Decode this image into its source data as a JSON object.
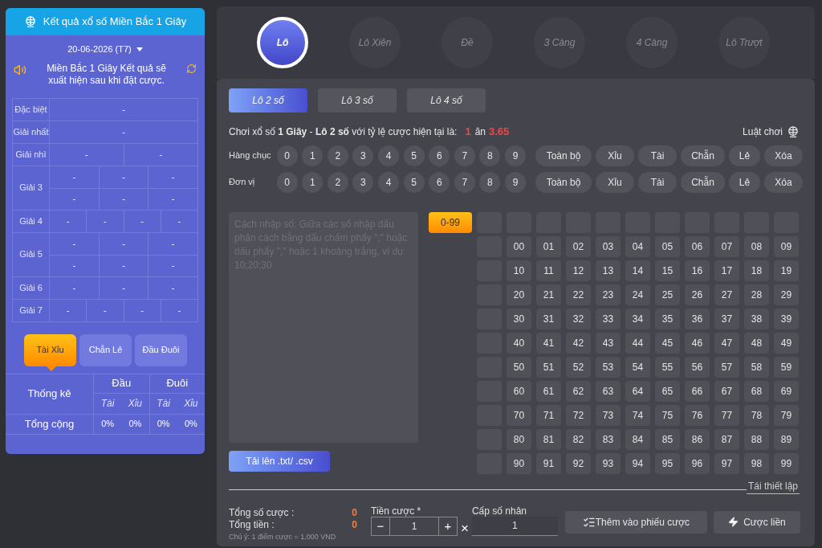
{
  "results": {
    "title": "Kết quả xổ số Miền Bắc 1 Giây",
    "date": "20-06-2026 (T7)",
    "notice": "Miền Bắc 1 Giây Kết quả sẽ xuất hiện sau khi đặt cược.",
    "prizes": [
      {
        "label": "Đặc biệt",
        "rows": [
          [
            "-"
          ]
        ]
      },
      {
        "label": "Giải nhất",
        "rows": [
          [
            "-"
          ]
        ]
      },
      {
        "label": "Giải nhì",
        "rows": [
          [
            "-",
            "-"
          ]
        ]
      },
      {
        "label": "Giải 3",
        "rows": [
          [
            "-",
            "-",
            "-"
          ],
          [
            "-",
            "-",
            "-"
          ]
        ]
      },
      {
        "label": "Giải 4",
        "rows": [
          [
            "-",
            "-",
            "-",
            "-"
          ]
        ]
      },
      {
        "label": "Giải 5",
        "rows": [
          [
            "-",
            "-",
            "-"
          ],
          [
            "-",
            "-",
            "-"
          ]
        ]
      },
      {
        "label": "Giải 6",
        "rows": [
          [
            "-",
            "-",
            "-"
          ]
        ]
      },
      {
        "label": "Giải 7",
        "rows": [
          [
            "-",
            "-",
            "-",
            "-"
          ]
        ]
      }
    ]
  },
  "stat_tabs": [
    {
      "label": "Tài Xỉu",
      "selected": true
    },
    {
      "label": "Chẵn Lẻ",
      "selected": false
    },
    {
      "label": "Đầu Đuôi",
      "selected": false
    }
  ],
  "stats": {
    "corner": "Thống kê",
    "groups": [
      "Đầu",
      "Đuôi"
    ],
    "subheads": [
      "Tài",
      "Xỉu",
      "Tài",
      "Xỉu"
    ],
    "row_label": "Tổng cộng",
    "values": [
      "0%",
      "0%",
      "0%",
      "0%"
    ]
  },
  "game_types": [
    {
      "label": "Lô",
      "selected": true
    },
    {
      "label": "Lô Xiên",
      "selected": false
    },
    {
      "label": "Đề",
      "selected": false
    },
    {
      "label": "3 Càng",
      "selected": false
    },
    {
      "label": "4 Càng",
      "selected": false
    },
    {
      "label": "Lô Trượt",
      "selected": false
    }
  ],
  "sub_tabs": [
    {
      "label": "Lô 2 số",
      "selected": true
    },
    {
      "label": "Lô 3 số",
      "selected": false
    },
    {
      "label": "Lô 4 số",
      "selected": false
    }
  ],
  "odds": {
    "text": "Chơi xổ số **1 Giây** - **Lô 2 số** với tỷ lệ cược hiện tại là:",
    "stake": "1",
    "eat": "ăn",
    "payout": "3.65",
    "rules": "Luật chơi"
  },
  "digit_rows": [
    {
      "label": "Hàng chục",
      "digits": [
        "0",
        "1",
        "2",
        "3",
        "4",
        "5",
        "6",
        "7",
        "8",
        "9"
      ],
      "quick": [
        "Toàn bộ",
        "Xỉu",
        "Tài",
        "Chẵn",
        "Lẻ",
        "Xóa"
      ]
    },
    {
      "label": "Đơn vị",
      "digits": [
        "0",
        "1",
        "2",
        "3",
        "4",
        "5",
        "6",
        "7",
        "8",
        "9"
      ],
      "quick": [
        "Toàn bộ",
        "Xỉu",
        "Tài",
        "Chẵn",
        "Lẻ",
        "Xóa"
      ]
    }
  ],
  "entry": {
    "placeholder": "Cách nhập số: Giữa các số nhập dấu phân cách bằng dấu chấm phẩy \";\" hoặc dấu phẩy \",\" hoặc 1 khoảng trắng, ví dụ: 10;20;30",
    "upload": "Tải lên .txt/ .csv",
    "range": "0-99"
  },
  "numbers": [
    [
      "00",
      "01",
      "02",
      "03",
      "04",
      "05",
      "06",
      "07",
      "08",
      "09"
    ],
    [
      "10",
      "11",
      "12",
      "13",
      "14",
      "15",
      "16",
      "17",
      "18",
      "19"
    ],
    [
      "20",
      "21",
      "22",
      "23",
      "24",
      "25",
      "26",
      "27",
      "28",
      "29"
    ],
    [
      "30",
      "31",
      "32",
      "33",
      "34",
      "35",
      "36",
      "37",
      "38",
      "39"
    ],
    [
      "40",
      "41",
      "42",
      "43",
      "44",
      "45",
      "46",
      "47",
      "48",
      "49"
    ],
    [
      "50",
      "51",
      "52",
      "53",
      "54",
      "55",
      "56",
      "57",
      "58",
      "59"
    ],
    [
      "60",
      "61",
      "62",
      "63",
      "64",
      "65",
      "66",
      "67",
      "68",
      "69"
    ],
    [
      "70",
      "71",
      "72",
      "73",
      "74",
      "75",
      "76",
      "77",
      "78",
      "79"
    ],
    [
      "80",
      "81",
      "82",
      "83",
      "84",
      "85",
      "86",
      "87",
      "88",
      "89"
    ],
    [
      "90",
      "91",
      "92",
      "93",
      "94",
      "95",
      "96",
      "97",
      "98",
      "99"
    ]
  ],
  "reset": "Tái thiết lập",
  "summary": {
    "count_label": "Tổng số cược :",
    "count": "0",
    "total_label": "Tổng tiền :",
    "total": "0",
    "note": "Chú ý: 1 điểm cược = 1,000 VND"
  },
  "bet": {
    "label": "Tiền cược *",
    "minus": "−",
    "value": "1",
    "plus": "+",
    "times": "×",
    "multiplier_label": "Cấp số nhân",
    "multiplier": "1"
  },
  "actions": {
    "add": "Thêm vào phiếu cược",
    "quick": "Cược liền"
  }
}
